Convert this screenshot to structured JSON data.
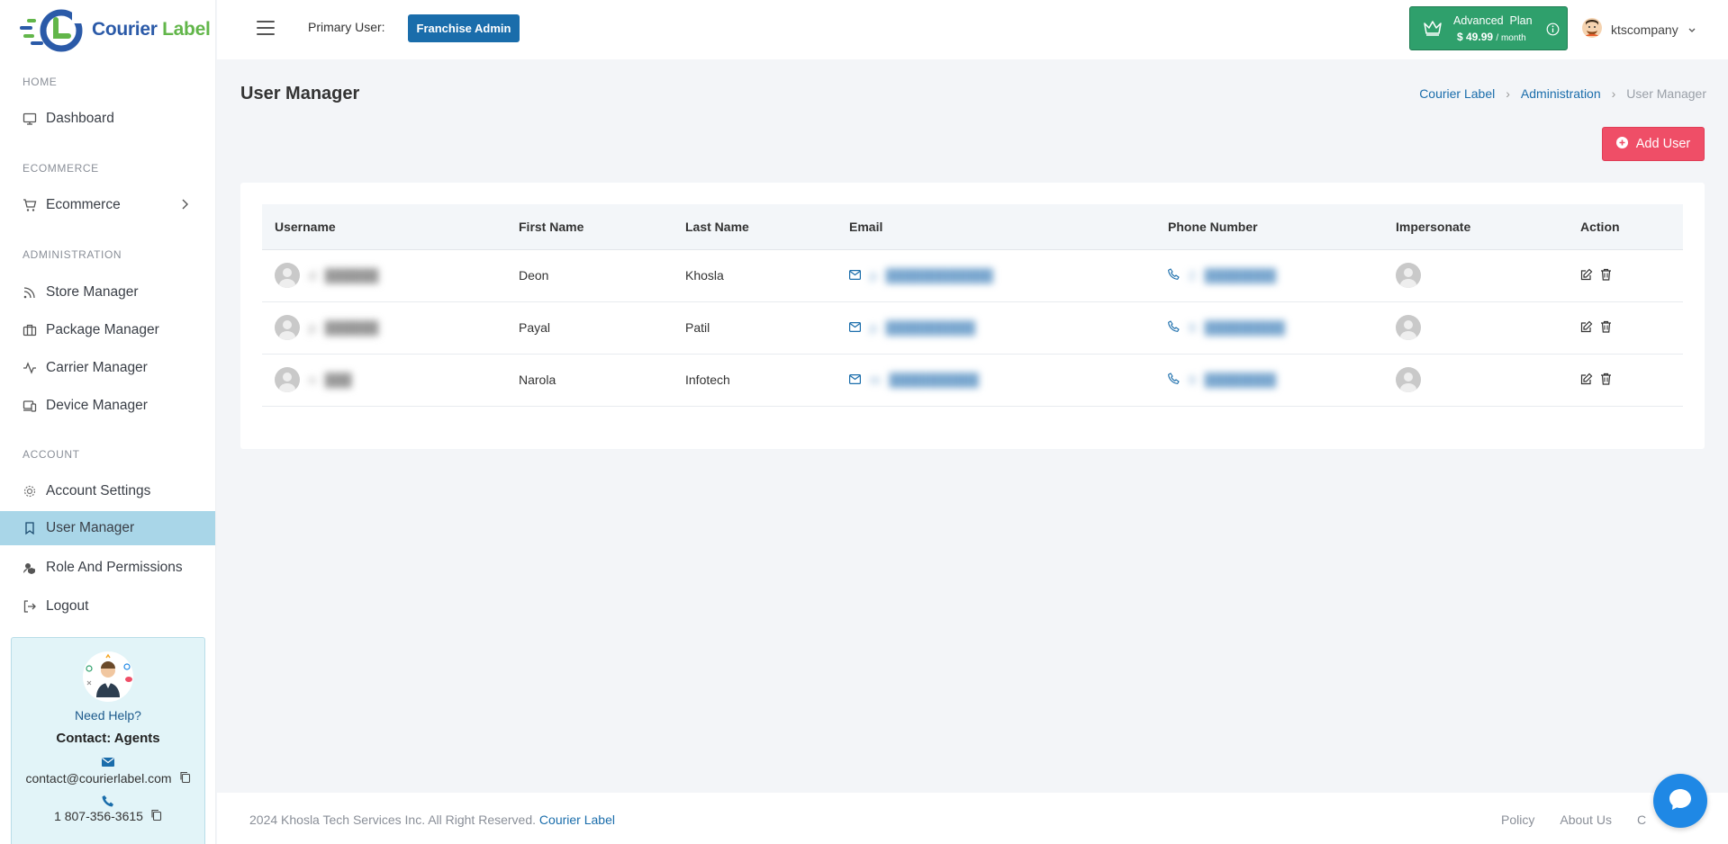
{
  "brand": {
    "name_part1": "Courier",
    "name_part2": "Label"
  },
  "sidebar": {
    "sections": {
      "home": "HOME",
      "ecommerce": "ECOMMERCE",
      "administration": "ADMINISTRATION",
      "account": "ACCOUNT"
    },
    "items": {
      "dashboard": "Dashboard",
      "ecommerce": "Ecommerce",
      "store_manager": "Store Manager",
      "package_manager": "Package Manager",
      "carrier_manager": "Carrier Manager",
      "device_manager": "Device Manager",
      "account_settings": "Account Settings",
      "user_manager": "User Manager",
      "role_permissions": "Role And Permissions",
      "logout": "Logout"
    },
    "help": {
      "title": "Need Help?",
      "contact": "Contact: Agents",
      "email": "contact@courierlabel.com",
      "phone": "1 807-356-3615"
    }
  },
  "header": {
    "primary_user_label": "Primary User:",
    "role": "Franchise Admin",
    "plan_name": "Advanced  Plan",
    "plan_price": "$ 49.99",
    "plan_period": "/ month",
    "username": "ktscompany"
  },
  "page": {
    "title": "User Manager",
    "breadcrumb": [
      "Courier Label",
      "Administration",
      "User Manager"
    ],
    "add_button": "Add User"
  },
  "table": {
    "columns": [
      "Username",
      "First Name",
      "Last Name",
      "Email",
      "Phone Number",
      "Impersonate",
      "Action"
    ],
    "rows": [
      {
        "username": "d",
        "first_name": "Deon",
        "last_name": "Khosla",
        "email": "p",
        "phone": "2"
      },
      {
        "username": "p",
        "first_name": "Payal",
        "last_name": "Patil",
        "email": "p",
        "phone": "9"
      },
      {
        "username": "n",
        "first_name": "Narola",
        "last_name": "Infotech",
        "email": "m",
        "phone": "9"
      }
    ]
  },
  "footer": {
    "copyright": "2024 Khosla Tech Services Inc. All Right Reserved.",
    "brand_link": "Courier Label",
    "links": [
      "Policy",
      "About Us",
      "C"
    ]
  },
  "colors": {
    "primary": "#1a6dab",
    "active_nav": "#a9d6e8",
    "add_button": "#ef4e67",
    "plan_box": "#2fa06c"
  }
}
